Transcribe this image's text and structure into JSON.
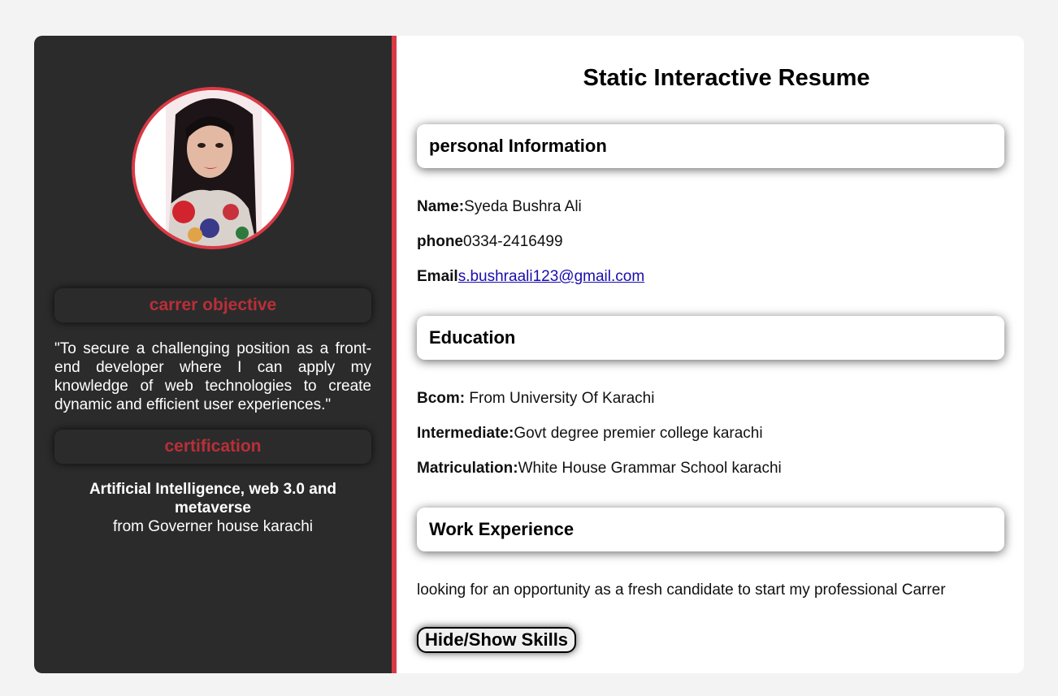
{
  "sidebar": {
    "objective_heading": "carrer objective",
    "objective_text": "\"To secure a challenging position as a front-end developer where I can apply my knowledge of web technologies to create dynamic and efficient user experiences.\"",
    "certification_heading": "certification",
    "certification_title": "Artificial Intelligence, web 3.0 and metaverse",
    "certification_source": "from Governer house karachi"
  },
  "main": {
    "title": "Static Interactive Resume",
    "personal": {
      "heading": "personal Information",
      "name_label": "Name:",
      "name_value": "Syeda Bushra Ali",
      "phone_label": "phone",
      "phone_value": "0334-2416499",
      "email_label": "Email",
      "email_value": "s.bushraali123@gmail.com"
    },
    "education": {
      "heading": "Education",
      "items": [
        {
          "label": "Bcom:",
          "value": " From University Of Karachi"
        },
        {
          "label": "Intermediate:",
          "value": "Govt degree premier college karachi"
        },
        {
          "label": "Matriculation:",
          "value": "White House Grammar School karachi"
        }
      ]
    },
    "work": {
      "heading": "Work Experience",
      "text": "looking for an opportunity as a fresh candidate to start my professional Carrer"
    },
    "toggle_button_label": "Hide/Show Skills"
  },
  "colors": {
    "accent": "#d93a45",
    "sidebar_bg": "#2b2b2b",
    "heading_red": "#b92f38",
    "link": "#1a0dab"
  }
}
